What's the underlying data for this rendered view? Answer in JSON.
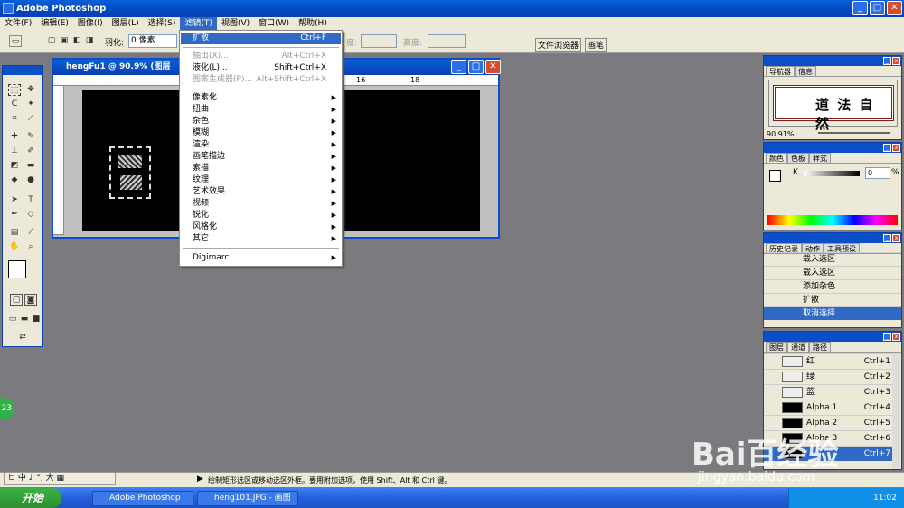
{
  "window": {
    "title": "Adobe Photoshop"
  },
  "menubar": [
    "文件(F)",
    "编辑(E)",
    "图像(I)",
    "图层(L)",
    "选择(S)",
    "滤镜(T)",
    "视图(V)",
    "窗口(W)",
    "帮助(H)"
  ],
  "options": {
    "feather_label": "羽化:",
    "feather_value": "0 像素",
    "width_label": "度:",
    "height_label": "高度:",
    "tab_file_browser": "文件浏览器",
    "tab_brushes": "画笔"
  },
  "document": {
    "title": "hengFu1 @ 90.9% (图层",
    "ruler_marks": [
      "16",
      "18"
    ]
  },
  "filter_menu": {
    "top_items": [
      {
        "label": "扩散",
        "shortcut": "Ctrl+F"
      },
      {
        "label": "抽出(X)...",
        "shortcut": "Alt+Ctrl+X"
      },
      {
        "label": "液化(L)...",
        "shortcut": "Shift+Ctrl+X"
      },
      {
        "label": "图案生成器(P)...",
        "shortcut": "Alt+Shift+Ctrl+X"
      }
    ],
    "submenus": [
      "像素化",
      "扭曲",
      "杂色",
      "模糊",
      "渲染",
      "画笔描边",
      "素描",
      "纹理",
      "艺术效果",
      "视频",
      "锐化",
      "风格化",
      "其它"
    ],
    "digimarc": "Digimarc"
  },
  "navigator": {
    "tabs": [
      "导航器",
      "信息"
    ],
    "zoom": "90.91%",
    "preview_text": "道 法 自 然"
  },
  "color_panel": {
    "tabs": [
      "颜色",
      "色板",
      "样式"
    ],
    "k_label": "K",
    "k_value": "0",
    "k_unit": "%"
  },
  "history": {
    "tabs": [
      "历史记录",
      "动作",
      "工具预设"
    ],
    "items": [
      "载入选区",
      "载入选区",
      "添加杂色",
      "扩散",
      "取消选择"
    ]
  },
  "channels": {
    "tabs": [
      "图层",
      "通道",
      "路径"
    ],
    "rows": [
      {
        "name": "红",
        "shortcut": "Ctrl+1"
      },
      {
        "name": "绿",
        "shortcut": "Ctrl+2"
      },
      {
        "name": "蓝",
        "shortcut": "Ctrl+3"
      },
      {
        "name": "Alpha 1",
        "shortcut": "Ctrl+4"
      },
      {
        "name": "Alpha 2",
        "shortcut": "Ctrl+5"
      },
      {
        "name": "Alpha 3",
        "shortcut": "Ctrl+6"
      },
      {
        "name": "",
        "shortcut": "Ctrl+7"
      }
    ]
  },
  "statusbar": {
    "text": "绘制矩形选区或移动选区外框。要用附加选项，使用 Shift、Alt 和 Ctrl 键。",
    "ime": "中 ♪ °, 大 ▦"
  },
  "taskbar": {
    "start": "开始",
    "items": [
      "Adobe Photoshop",
      "heng101.JPG - 画图"
    ],
    "clock": "11:02"
  },
  "watermark": {
    "brand": "Bai百经验",
    "url": "jingyan.baidu.com"
  },
  "badge": "23"
}
